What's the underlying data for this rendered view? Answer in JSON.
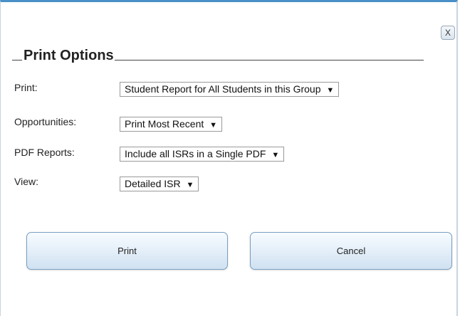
{
  "dialog": {
    "title": "Print Options",
    "close_label": "X"
  },
  "options": {
    "print": {
      "label": "Print:",
      "value": "Student Report for All Students in this Group"
    },
    "opportunities": {
      "label": "Opportunities:",
      "value": "Print Most Recent"
    },
    "pdf_reports": {
      "label": "PDF Reports:",
      "value": "Include all ISRs in a Single PDF"
    },
    "view": {
      "label": "View:",
      "value": "Detailed ISR"
    }
  },
  "buttons": {
    "print_label": "Print",
    "cancel_label": "Cancel"
  },
  "icons": {
    "dropdown": "triangle-down-icon",
    "close": "close-icon"
  },
  "colors": {
    "accent": "#4a90c8",
    "button_border": "#7a9fc0"
  }
}
